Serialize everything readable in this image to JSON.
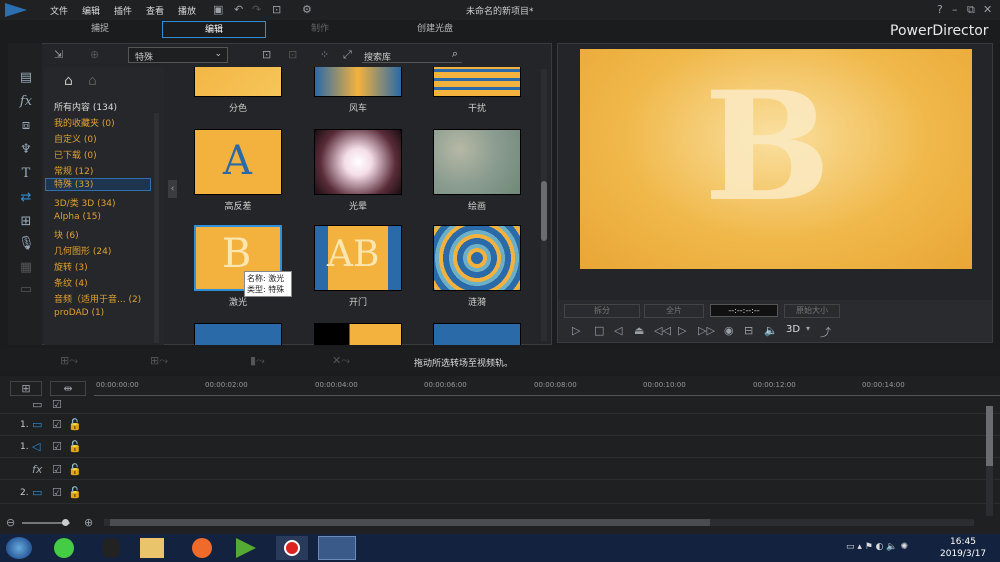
{
  "menu": [
    "文件",
    "编辑",
    "插件",
    "查看",
    "播放"
  ],
  "window_title": "未命名的新项目*",
  "brand": "PowerDirector",
  "tabs": [
    "捕捉",
    "编辑",
    "制作",
    "创建光盘"
  ],
  "library": {
    "dropdown": "特殊",
    "search_placeholder": "搜索库",
    "categories": [
      {
        "label": "所有内容 (134)",
        "color": "white"
      },
      {
        "label": "我的收藏夹 (0)"
      },
      {
        "label": "自定义 (0)"
      },
      {
        "label": "已下载 (0)"
      },
      {
        "label": "常规 (12)"
      },
      {
        "label": "特殊 (33)",
        "selected": true
      },
      {
        "label": "3D/类 3D (34)"
      },
      {
        "label": "Alpha (15)"
      },
      {
        "label": "块 (6)"
      },
      {
        "label": "几何图形 (24)"
      },
      {
        "label": "旋转 (3)"
      },
      {
        "label": "条纹 (4)"
      },
      {
        "label": "音频（适用于音... (2)"
      },
      {
        "label": "proDAD (1)"
      }
    ],
    "thumbnails": [
      {
        "label": "分色",
        "icon": "split-color"
      },
      {
        "label": "风车",
        "icon": "windmill"
      },
      {
        "label": "干扰",
        "icon": "interference"
      },
      {
        "label": "高反差",
        "icon": "high-contrast"
      },
      {
        "label": "光晕",
        "icon": "halo"
      },
      {
        "label": "绘画",
        "icon": "paint"
      },
      {
        "label": "激光",
        "icon": "laser"
      },
      {
        "label": "开门",
        "icon": "open-door"
      },
      {
        "label": "涟漪",
        "icon": "ripple"
      }
    ],
    "tooltip": {
      "name": "名称: 激光",
      "type": "类型: 特殊"
    }
  },
  "preview": {
    "letter": "B",
    "btn_split": "拆分",
    "btn_full": "全片",
    "timecode": "--:--:--:--",
    "size": "原始大小",
    "mode": "3D"
  },
  "toolbar_hint": "拖动所选转场至视频轨。",
  "timeline": {
    "ticks": [
      "00:00:00:00",
      "00:00:02:00",
      "00:00:04:00",
      "00:00:06:00",
      "00:00:08:00",
      "00:00:10:00",
      "00:00:12:00",
      "00:00:14:00"
    ],
    "tracks": [
      {
        "num": ""
      },
      {
        "num": "1."
      },
      {
        "num": "1."
      },
      {
        "num": ""
      },
      {
        "num": "2."
      }
    ]
  },
  "taskbar": {
    "time": "16:45",
    "date": "2019/3/17"
  },
  "colors": {
    "accent": "#2f8fd8",
    "category": "#e0a030",
    "preview_bg": "#f0b84a"
  }
}
